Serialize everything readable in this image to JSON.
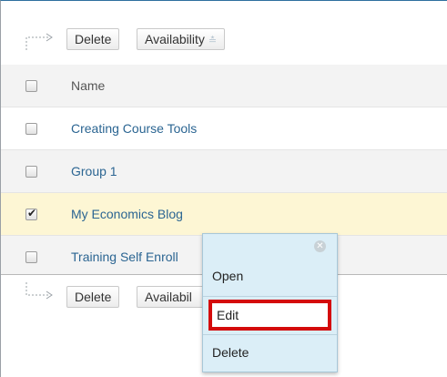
{
  "toolbar": {
    "delete_label": "Delete",
    "availability_label": "Availability"
  },
  "table": {
    "column_name": "Name",
    "rows": [
      {
        "name": "Creating Course Tools",
        "checked": false
      },
      {
        "name": "Group 1",
        "checked": false
      },
      {
        "name": "My Economics Blog",
        "checked": true
      },
      {
        "name": "Training Self Enroll",
        "checked": false
      }
    ]
  },
  "bottom_toolbar": {
    "delete_label": "Delete",
    "availability_label": "Availabil"
  },
  "context_menu": {
    "items": [
      "Open",
      "Edit",
      "Delete"
    ],
    "close_icon": "close-circle-icon",
    "highlight_color": "#d40b0b"
  },
  "icons": {
    "toolbar_arrow": "corner-arrow-icon",
    "availability_chevron": "double-chevron-down-icon"
  }
}
